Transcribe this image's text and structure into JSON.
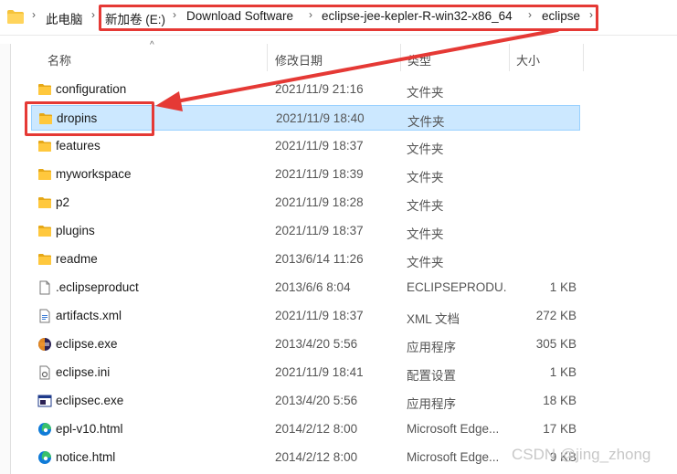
{
  "breadcrumbs": [
    "此电脑",
    "新加卷 (E:)",
    "Download Software",
    "eclipse-jee-kepler-R-win32-x86_64",
    "eclipse"
  ],
  "columns": {
    "name": "名称",
    "date": "修改日期",
    "type": "类型",
    "size": "大小"
  },
  "files": [
    {
      "name": "configuration",
      "date": "2021/11/9 21:16",
      "type": "文件夹",
      "size": "",
      "icon": "folder-icon"
    },
    {
      "name": "dropins",
      "date": "2021/11/9 18:40",
      "type": "文件夹",
      "size": "",
      "icon": "folder-icon"
    },
    {
      "name": "features",
      "date": "2021/11/9 18:37",
      "type": "文件夹",
      "size": "",
      "icon": "folder-icon"
    },
    {
      "name": "myworkspace",
      "date": "2021/11/9 18:39",
      "type": "文件夹",
      "size": "",
      "icon": "folder-icon"
    },
    {
      "name": "p2",
      "date": "2021/11/9 18:28",
      "type": "文件夹",
      "size": "",
      "icon": "folder-icon"
    },
    {
      "name": "plugins",
      "date": "2021/11/9 18:37",
      "type": "文件夹",
      "size": "",
      "icon": "folder-icon"
    },
    {
      "name": "readme",
      "date": "2013/6/14 11:26",
      "type": "文件夹",
      "size": "",
      "icon": "folder-icon"
    },
    {
      "name": ".eclipseproduct",
      "date": "2013/6/6 8:04",
      "type": "ECLIPSEPRODU...",
      "size": "1 KB",
      "icon": "blank-file-icon"
    },
    {
      "name": "artifacts.xml",
      "date": "2021/11/9 18:37",
      "type": "XML 文档",
      "size": "272 KB",
      "icon": "xml-file-icon"
    },
    {
      "name": "eclipse.exe",
      "date": "2013/4/20 5:56",
      "type": "应用程序",
      "size": "305 KB",
      "icon": "eclipse-app-icon"
    },
    {
      "name": "eclipse.ini",
      "date": "2021/11/9 18:41",
      "type": "配置设置",
      "size": "1 KB",
      "icon": "ini-file-icon"
    },
    {
      "name": "eclipsec.exe",
      "date": "2013/4/20 5:56",
      "type": "应用程序",
      "size": "18 KB",
      "icon": "console-app-icon"
    },
    {
      "name": "epl-v10.html",
      "date": "2014/2/12 8:00",
      "type": "Microsoft Edge...",
      "size": "17 KB",
      "icon": "edge-icon"
    },
    {
      "name": "notice.html",
      "date": "2014/2/12 8:00",
      "type": "Microsoft Edge...",
      "size": "9 KB",
      "icon": "edge-icon"
    }
  ],
  "watermark": "CSDN @jing_zhong",
  "colors": {
    "highlight": "#e53935",
    "selection": "#cce8ff",
    "folder": "#f5c33b"
  }
}
